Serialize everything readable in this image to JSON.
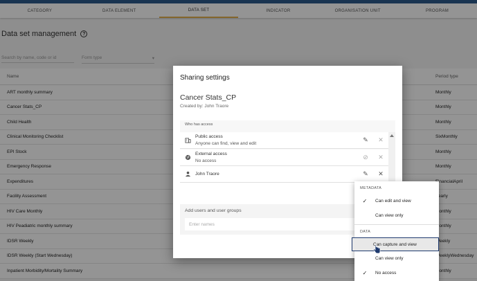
{
  "tabs": [
    "CATEGORY",
    "DATA ELEMENT",
    "DATA SET",
    "INDICATOR",
    "ORGANISATION UNIT",
    "PROGRAM"
  ],
  "active_tab": 2,
  "page_title": "Data set management",
  "search_placeholder": "Search by name, code or id",
  "form_type_placeholder": "Form type",
  "table": {
    "col_name": "Name",
    "col_period": "Period type",
    "rows": [
      {
        "name": "ART monthly summary",
        "period": "Monthly"
      },
      {
        "name": "Cancer Stats_CP",
        "period": "Monthly"
      },
      {
        "name": "Child Health",
        "period": "Monthly"
      },
      {
        "name": "Clinical Monitoring Checklist",
        "period": "SixMonthly"
      },
      {
        "name": "EPI Stock",
        "period": "Monthly"
      },
      {
        "name": "Emergency Response",
        "period": "Monthly"
      },
      {
        "name": "Expenditures",
        "period": "FinancialApril"
      },
      {
        "name": "Facility Assessment",
        "period": "Yearly"
      },
      {
        "name": "HIV Care Monthly",
        "period": "Monthly"
      },
      {
        "name": "HIV Peadiatric monthly summary",
        "period": "Monthly"
      },
      {
        "name": "IDSR Weekly",
        "period": "Weekly"
      },
      {
        "name": "IDSR Weekly (Start Wednesday)",
        "period": "WeeklyWednesday"
      },
      {
        "name": "Inpatient Morbidity/Mortality Summary",
        "period": "Monthly"
      }
    ]
  },
  "dialog": {
    "title": "Sharing settings",
    "dataset_name": "Cancer Stats_CP",
    "created_by": "Created by: John Traore",
    "who_has_access": "Who has access",
    "entries": [
      {
        "name": "Public access",
        "desc": "Anyone can find, view and edit"
      },
      {
        "name": "External access",
        "desc": "No access"
      },
      {
        "name": "John Traore",
        "desc": ""
      }
    ],
    "add_title": "Add users and user groups",
    "names_placeholder": "Enter names"
  },
  "menu": {
    "metadata_label": "METADATA",
    "metadata_items": [
      "Can edit and view",
      "Can view only"
    ],
    "data_label": "DATA",
    "data_items": [
      "Can capture and view",
      "Can view only",
      "No access"
    ]
  },
  "icons": {
    "public": "building-icon",
    "external": "globe-icon",
    "user": "person-icon",
    "edit": "pencil-icon",
    "remove": "close-icon",
    "blocked": "block-icon",
    "check": "check-icon"
  },
  "colors": {
    "accent": "#e3b04b",
    "topbar": "#2c5a8c",
    "highlight_border": "#1f3a6e"
  }
}
